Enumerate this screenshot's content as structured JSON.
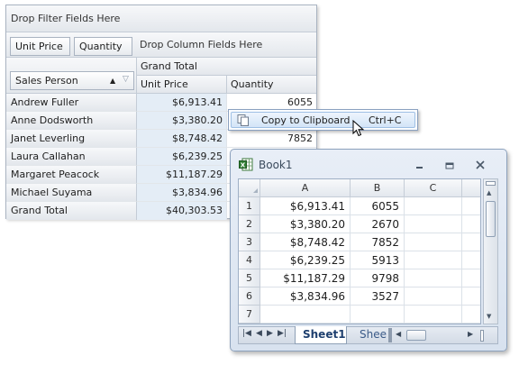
{
  "pivot": {
    "filter_area": "Drop Filter Fields Here",
    "data_fields": [
      "Unit Price",
      "Quantity"
    ],
    "column_area": "Drop Column Fields Here",
    "grand_total_header": "Grand Total",
    "row_field": "Sales Person",
    "col_headers": [
      "Unit Price",
      "Quantity"
    ],
    "rows": [
      {
        "name": "Andrew Fuller",
        "price": "$6,913.41",
        "qty": "6055"
      },
      {
        "name": "Anne Dodsworth",
        "price": "$3,380.20",
        "qty": ""
      },
      {
        "name": "Janet Leverling",
        "price": "$8,748.42",
        "qty": "7852"
      },
      {
        "name": "Laura Callahan",
        "price": "$6,239.25",
        "qty": ""
      },
      {
        "name": "Margaret Peacock",
        "price": "$11,187.29",
        "qty": ""
      },
      {
        "name": "Michael Suyama",
        "price": "$3,834.96",
        "qty": ""
      },
      {
        "name": "Grand Total",
        "price": "$40,303.53",
        "qty": ""
      }
    ]
  },
  "context_menu": {
    "item_label": "Copy to Clipboard",
    "shortcut": "Ctrl+C"
  },
  "excel": {
    "title": "Book1",
    "columns": [
      "A",
      "B",
      "C"
    ],
    "rows": [
      {
        "num": "1",
        "a": "$6,913.41",
        "b": "6055"
      },
      {
        "num": "2",
        "a": "$3,380.20",
        "b": "2670"
      },
      {
        "num": "3",
        "a": "$8,748.42",
        "b": "7852"
      },
      {
        "num": "4",
        "a": "$6,239.25",
        "b": "5913"
      },
      {
        "num": "5",
        "a": "$11,187.29",
        "b": "9798"
      },
      {
        "num": "6",
        "a": "$3,834.96",
        "b": "3527"
      },
      {
        "num": "7",
        "a": "",
        "b": ""
      }
    ],
    "sheet_tabs": [
      "Sheet1",
      "Sheet"
    ]
  }
}
